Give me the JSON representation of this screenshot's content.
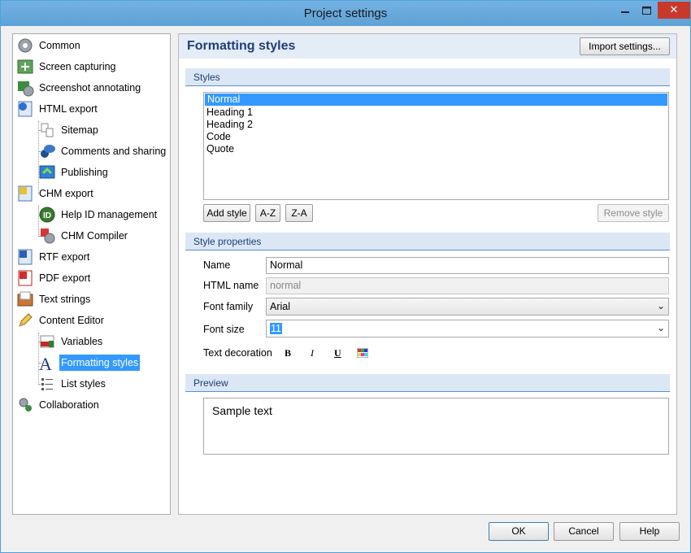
{
  "window": {
    "title": "Project settings"
  },
  "nav": {
    "items": [
      {
        "label": "Common",
        "icon": "gear-icon"
      },
      {
        "label": "Screen capturing",
        "icon": "screen-capture-icon"
      },
      {
        "label": "Screenshot annotating",
        "icon": "annotate-icon"
      },
      {
        "label": "HTML export",
        "icon": "html-export-icon"
      },
      {
        "label": "Sitemap",
        "icon": "sitemap-icon"
      },
      {
        "label": "Comments and sharing",
        "icon": "comments-icon"
      },
      {
        "label": "Publishing",
        "icon": "publishing-icon"
      },
      {
        "label": "CHM export",
        "icon": "chm-export-icon"
      },
      {
        "label": "Help ID management",
        "icon": "help-id-icon"
      },
      {
        "label": "CHM Compiler",
        "icon": "chm-compiler-icon"
      },
      {
        "label": "RTF export",
        "icon": "rtf-export-icon"
      },
      {
        "label": "PDF export",
        "icon": "pdf-export-icon"
      },
      {
        "label": "Text strings",
        "icon": "text-strings-icon"
      },
      {
        "label": "Content Editor",
        "icon": "pencil-icon"
      },
      {
        "label": "Variables",
        "icon": "variables-icon"
      },
      {
        "label": "Formatting styles",
        "icon": "formatting-styles-icon",
        "selected": true
      },
      {
        "label": "List styles",
        "icon": "list-styles-icon"
      },
      {
        "label": "Collaboration",
        "icon": "collaboration-icon"
      }
    ]
  },
  "main": {
    "title": "Formatting styles",
    "import_label": "Import settings...",
    "styles_section": "Styles",
    "styles": [
      "Normal",
      "Heading 1",
      "Heading 2",
      "Code",
      "Quote"
    ],
    "selected_style": "Normal",
    "add_style": "Add style",
    "sort_az": "A-Z",
    "sort_za": "Z-A",
    "remove_style": "Remove style",
    "props_section": "Style properties",
    "name_label": "Name",
    "name_value": "Normal",
    "html_name_label": "HTML name",
    "html_name_placeholder": "normal",
    "font_family_label": "Font family",
    "font_family_value": "Arial",
    "font_size_label": "Font size",
    "font_size_value": "11",
    "text_decoration_label": "Text decoration",
    "bold_label": "B",
    "italic_label": "I",
    "underline_label": "U",
    "preview_section": "Preview",
    "preview_text": "Sample text"
  },
  "footer": {
    "ok": "OK",
    "cancel": "Cancel",
    "help": "Help"
  },
  "colors": {
    "accent": "#3399ff",
    "header_text": "#1e3f78",
    "close": "#c7392b"
  }
}
